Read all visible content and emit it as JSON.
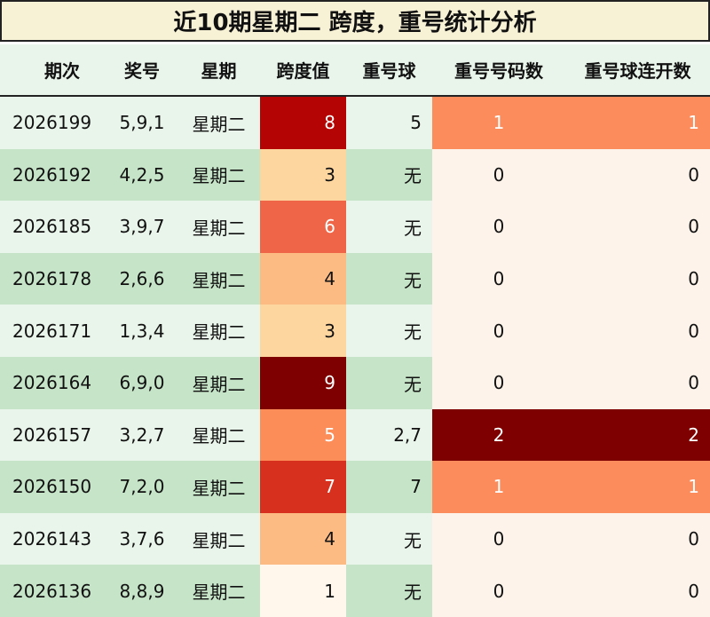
{
  "title": "近10期星期二 跨度，重号统计分析",
  "headers": [
    "期次",
    "奖号",
    "星期",
    "跨度值",
    "重号球",
    "重号号码数",
    "重号球连开数"
  ],
  "colors": {
    "row_light": "#e9f4ea",
    "row_dark": "#c6e4c8",
    "cell_white_bg": "#fdf3ea"
  },
  "rows": [
    {
      "period": "2026199",
      "numbers": "5,9,1",
      "day": "星期二",
      "span": "8",
      "repeat_balls": "5",
      "repeat_count": "1",
      "repeat_consec": "1",
      "span_color": "#b50404",
      "repeat_color": "#fc8c5c"
    },
    {
      "period": "2026192",
      "numbers": "4,2,5",
      "day": "星期二",
      "span": "3",
      "repeat_balls": "无",
      "repeat_count": "0",
      "repeat_consec": "0",
      "span_color": "#fdd59e",
      "repeat_color": ""
    },
    {
      "period": "2026185",
      "numbers": "3,9,7",
      "day": "星期二",
      "span": "6",
      "repeat_balls": "无",
      "repeat_count": "0",
      "repeat_consec": "0",
      "span_color": "#ef6548",
      "repeat_color": ""
    },
    {
      "period": "2026178",
      "numbers": "2,6,6",
      "day": "星期二",
      "span": "4",
      "repeat_balls": "无",
      "repeat_count": "0",
      "repeat_consec": "0",
      "span_color": "#fdbb84",
      "repeat_color": ""
    },
    {
      "period": "2026171",
      "numbers": "1,3,4",
      "day": "星期二",
      "span": "3",
      "repeat_balls": "无",
      "repeat_count": "0",
      "repeat_consec": "0",
      "span_color": "#fdd59e",
      "repeat_color": ""
    },
    {
      "period": "2026164",
      "numbers": "6,9,0",
      "day": "星期二",
      "span": "9",
      "repeat_balls": "无",
      "repeat_count": "0",
      "repeat_consec": "0",
      "span_color": "#7f0000",
      "repeat_color": ""
    },
    {
      "period": "2026157",
      "numbers": "3,2,7",
      "day": "星期二",
      "span": "5",
      "repeat_balls": "2,7",
      "repeat_count": "2",
      "repeat_consec": "2",
      "span_color": "#fc8d59",
      "repeat_color": "#7f0000"
    },
    {
      "period": "2026150",
      "numbers": "7,2,0",
      "day": "星期二",
      "span": "7",
      "repeat_balls": "7",
      "repeat_count": "1",
      "repeat_consec": "1",
      "span_color": "#d7301f",
      "repeat_color": "#fc8c5c"
    },
    {
      "period": "2026143",
      "numbers": "3,7,6",
      "day": "星期二",
      "span": "4",
      "repeat_balls": "无",
      "repeat_count": "0",
      "repeat_consec": "0",
      "span_color": "#fdbb84",
      "repeat_color": ""
    },
    {
      "period": "2026136",
      "numbers": "8,8,9",
      "day": "星期二",
      "span": "1",
      "repeat_balls": "无",
      "repeat_count": "0",
      "repeat_consec": "0",
      "span_color": "#fff7ec",
      "repeat_color": ""
    }
  ]
}
